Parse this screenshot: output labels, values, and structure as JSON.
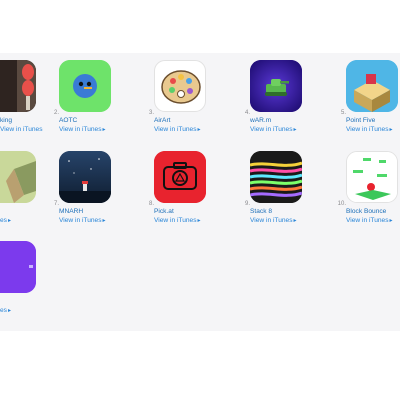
{
  "apps": [
    {
      "rank": "",
      "name": "king",
      "link": "View in iTunes",
      "icon": "bowling-pins-icon",
      "color": "#3a2a28"
    },
    {
      "rank": "2.",
      "name": "AOTC",
      "link": "View in iTunes",
      "icon": "green-circle-face-icon",
      "color": "#6ee36a"
    },
    {
      "rank": "3.",
      "name": "AirArt",
      "link": "View in iTunes",
      "icon": "paint-palette-icon",
      "color": "#ffffff"
    },
    {
      "rank": "4.",
      "name": "wAR.m",
      "link": "View in iTunes",
      "icon": "tank-icon",
      "color": "#3a1aa8"
    },
    {
      "rank": "5.",
      "name": "Point Five",
      "link": "View in iTunes",
      "icon": "isometric-block-icon",
      "color": "#4fb6e6"
    },
    {
      "rank": "",
      "name": "",
      "link": "es",
      "icon": "isometric-path-icon",
      "color": "#c9d89a"
    },
    {
      "rank": "7.",
      "name": "MNARH",
      "link": "View in iTunes",
      "icon": "night-lighthouse-icon",
      "color": "#1f3550"
    },
    {
      "rank": "8.",
      "name": "Pick.at",
      "link": "View in iTunes",
      "icon": "camera-icon",
      "color": "#e8232e"
    },
    {
      "rank": "9.",
      "name": "Stack 8",
      "link": "View in iTunes",
      "icon": "neon-stripes-icon",
      "color": "#1a1a1a"
    },
    {
      "rank": "10.",
      "name": "Block Bounce",
      "link": "View in iTunes",
      "icon": "bouncing-block-icon",
      "color": "#ffffff"
    },
    {
      "rank": "",
      "name": "",
      "link": "es",
      "icon": "purple-app-icon",
      "color": "#7c3aed"
    }
  ]
}
